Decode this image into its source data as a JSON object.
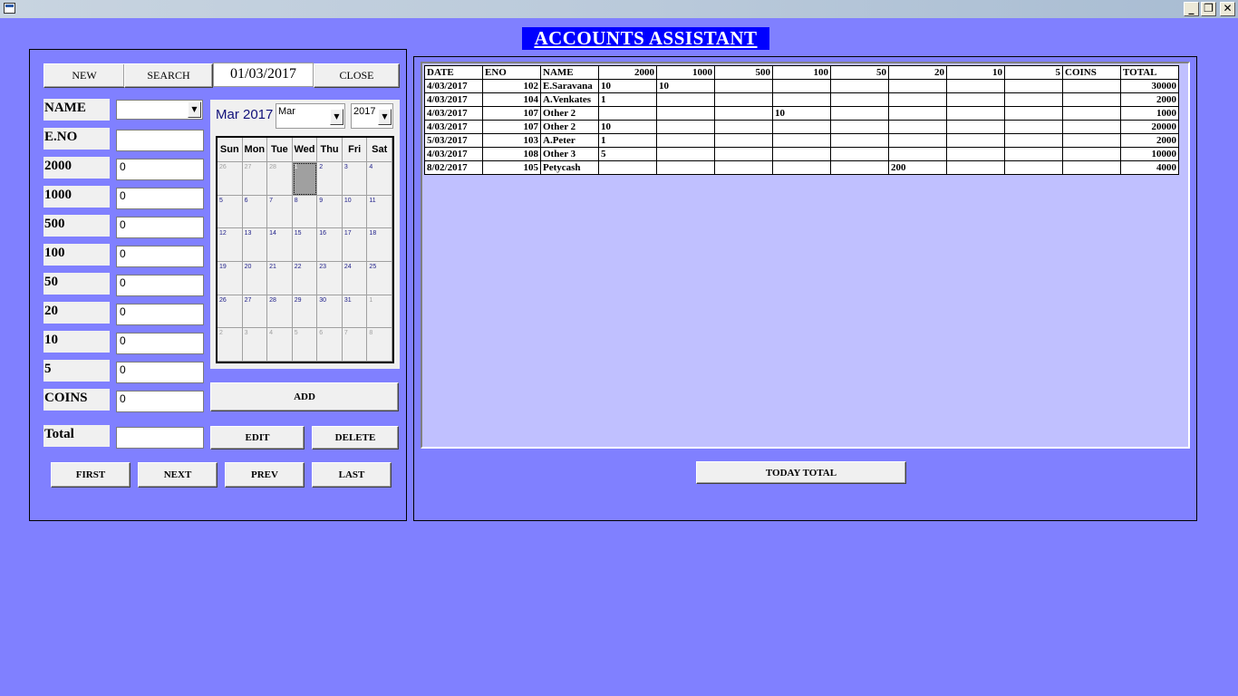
{
  "window": {
    "minimize": "_",
    "restore": "❐",
    "close": "✕"
  },
  "app_title": "ACCOUNTS  ASSISTANT",
  "toolbar": {
    "new": "NEW",
    "search": "SEARCH",
    "date": "01/03/2017",
    "close": "CLOSE"
  },
  "form": {
    "fields": [
      {
        "label": "NAME",
        "value": ""
      },
      {
        "label": " E.NO",
        "value": ""
      },
      {
        "label": "2000",
        "value": "0"
      },
      {
        "label": "1000",
        "value": "0"
      },
      {
        "label": "500",
        "value": "0"
      },
      {
        "label": "100",
        "value": "0"
      },
      {
        "label": "50",
        "value": "0"
      },
      {
        "label": "20",
        "value": "0"
      },
      {
        "label": "10",
        "value": "0"
      },
      {
        "label": "5",
        "value": "0"
      },
      {
        "label": "COINS",
        "value": "0"
      },
      {
        "label": "Total",
        "value": ""
      }
    ]
  },
  "calendar": {
    "title": "Mar 2017",
    "month_select": "Mar",
    "year_select": "2017",
    "days": [
      "Sun",
      "Mon",
      "Tue",
      "Wed",
      "Thu",
      "Fri",
      "Sat"
    ],
    "cells": [
      "26",
      "27",
      "28",
      "1",
      "2",
      "3",
      "4",
      "5",
      "6",
      "7",
      "8",
      "9",
      "10",
      "11",
      "12",
      "13",
      "14",
      "15",
      "16",
      "17",
      "18",
      "19",
      "20",
      "21",
      "22",
      "23",
      "24",
      "25",
      "26",
      "27",
      "28",
      "29",
      "30",
      "31",
      "1",
      "2",
      "3",
      "4",
      "5",
      "6",
      "7",
      "8"
    ]
  },
  "buttons": {
    "add": "ADD",
    "edit": "EDIT",
    "delete": "DELETE",
    "first": "FIRST",
    "next": "NEXT",
    "prev": "PREV",
    "last": "LAST",
    "today_total": "TODAY TOTAL"
  },
  "table": {
    "headers": [
      "DATE",
      "ENO",
      "NAME",
      "2000",
      "1000",
      "500",
      "100",
      "50",
      "20",
      "10",
      "5",
      "COINS",
      "TOTAL"
    ],
    "rows": [
      [
        "4/03/2017",
        "102",
        "E.Saravana",
        "10",
        "10",
        "",
        "",
        "",
        "",
        "",
        "",
        "",
        "30000"
      ],
      [
        "4/03/2017",
        "104",
        "A.Venkates",
        "1",
        "",
        "",
        "",
        "",
        "",
        "",
        "",
        "",
        "2000"
      ],
      [
        "4/03/2017",
        "107",
        "Other 2",
        "",
        "",
        "",
        "10",
        "",
        "",
        "",
        "",
        "",
        "1000"
      ],
      [
        "4/03/2017",
        "107",
        "Other 2",
        "10",
        "",
        "",
        "",
        "",
        "",
        "",
        "",
        "",
        "20000"
      ],
      [
        "5/03/2017",
        "103",
        "A.Peter",
        "1",
        "",
        "",
        "",
        "",
        "",
        "",
        "",
        "",
        "2000"
      ],
      [
        "4/03/2017",
        "108",
        "Other 3",
        "5",
        "",
        "",
        "",
        "",
        "",
        "",
        "",
        "",
        "10000"
      ],
      [
        "8/02/2017",
        "105",
        "Petycash",
        "",
        "",
        "",
        "",
        "",
        "200",
        "",
        "",
        "",
        "4000"
      ]
    ]
  }
}
